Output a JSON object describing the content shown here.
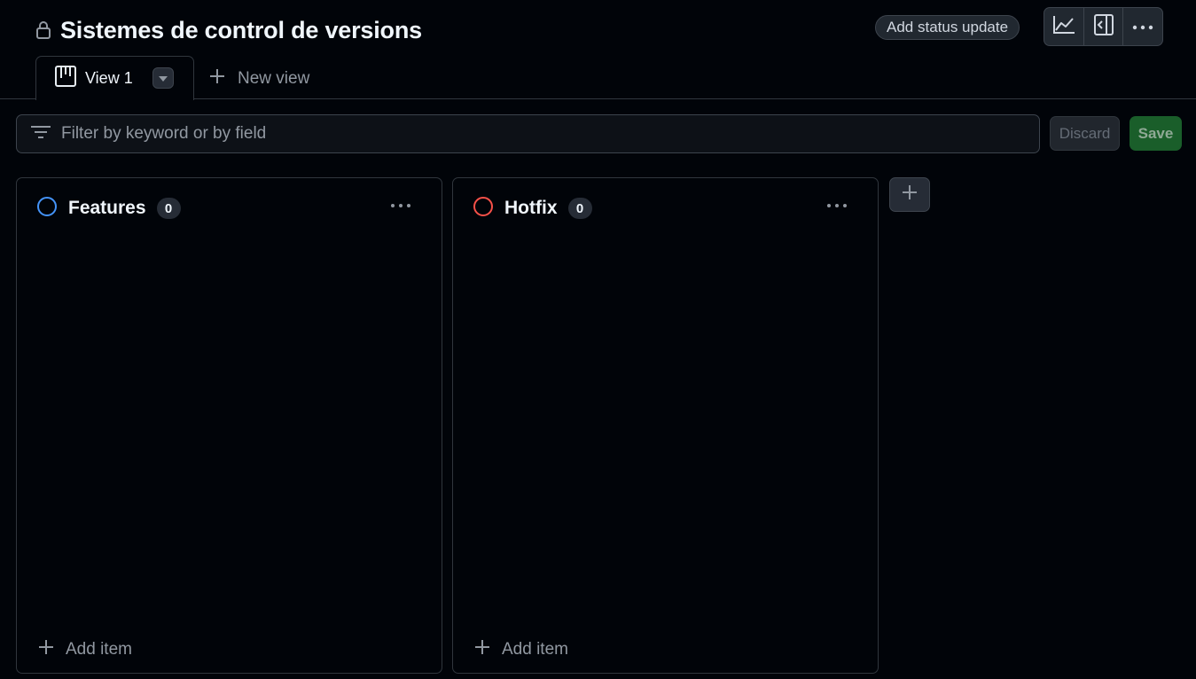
{
  "project": {
    "title": "Sistemes de control de versions"
  },
  "header": {
    "status_button_label": "Add status update",
    "icons": [
      "insights-icon",
      "sidebar-icon",
      "kebab-horizontal-icon"
    ]
  },
  "tabs": {
    "active": {
      "label": "View 1",
      "icon": "board-icon"
    },
    "new_view_label": "New view"
  },
  "filter": {
    "placeholder": "Filter by keyword or by field",
    "value": "",
    "discard_label": "Discard",
    "save_label": "Save"
  },
  "columns": [
    {
      "name": "Features",
      "count": "0",
      "status_color": "#4493f8",
      "add_item_label": "Add item"
    },
    {
      "name": "Hotfix",
      "count": "0",
      "status_color": "#f85149",
      "add_item_label": "Add item"
    }
  ],
  "colors": {
    "background": "#010409",
    "border": "#30363d",
    "save_button": "#1a5e2a"
  }
}
